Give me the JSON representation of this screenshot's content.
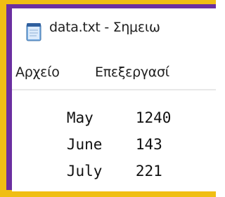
{
  "window": {
    "title": "data.txt - Σημειω",
    "icon": "notepad-icon"
  },
  "menu": {
    "items": [
      "Αρχείο",
      "Επεξεργασί"
    ]
  },
  "document": {
    "lines": [
      {
        "month": "May",
        "value": "1240"
      },
      {
        "month": "June",
        "value": "143"
      },
      {
        "month": "July",
        "value": "221"
      }
    ]
  },
  "colors": {
    "frame_border": "#f0be14",
    "frame_fill": "#6b2fa0",
    "background": "#ffffff",
    "text": "#111111"
  }
}
